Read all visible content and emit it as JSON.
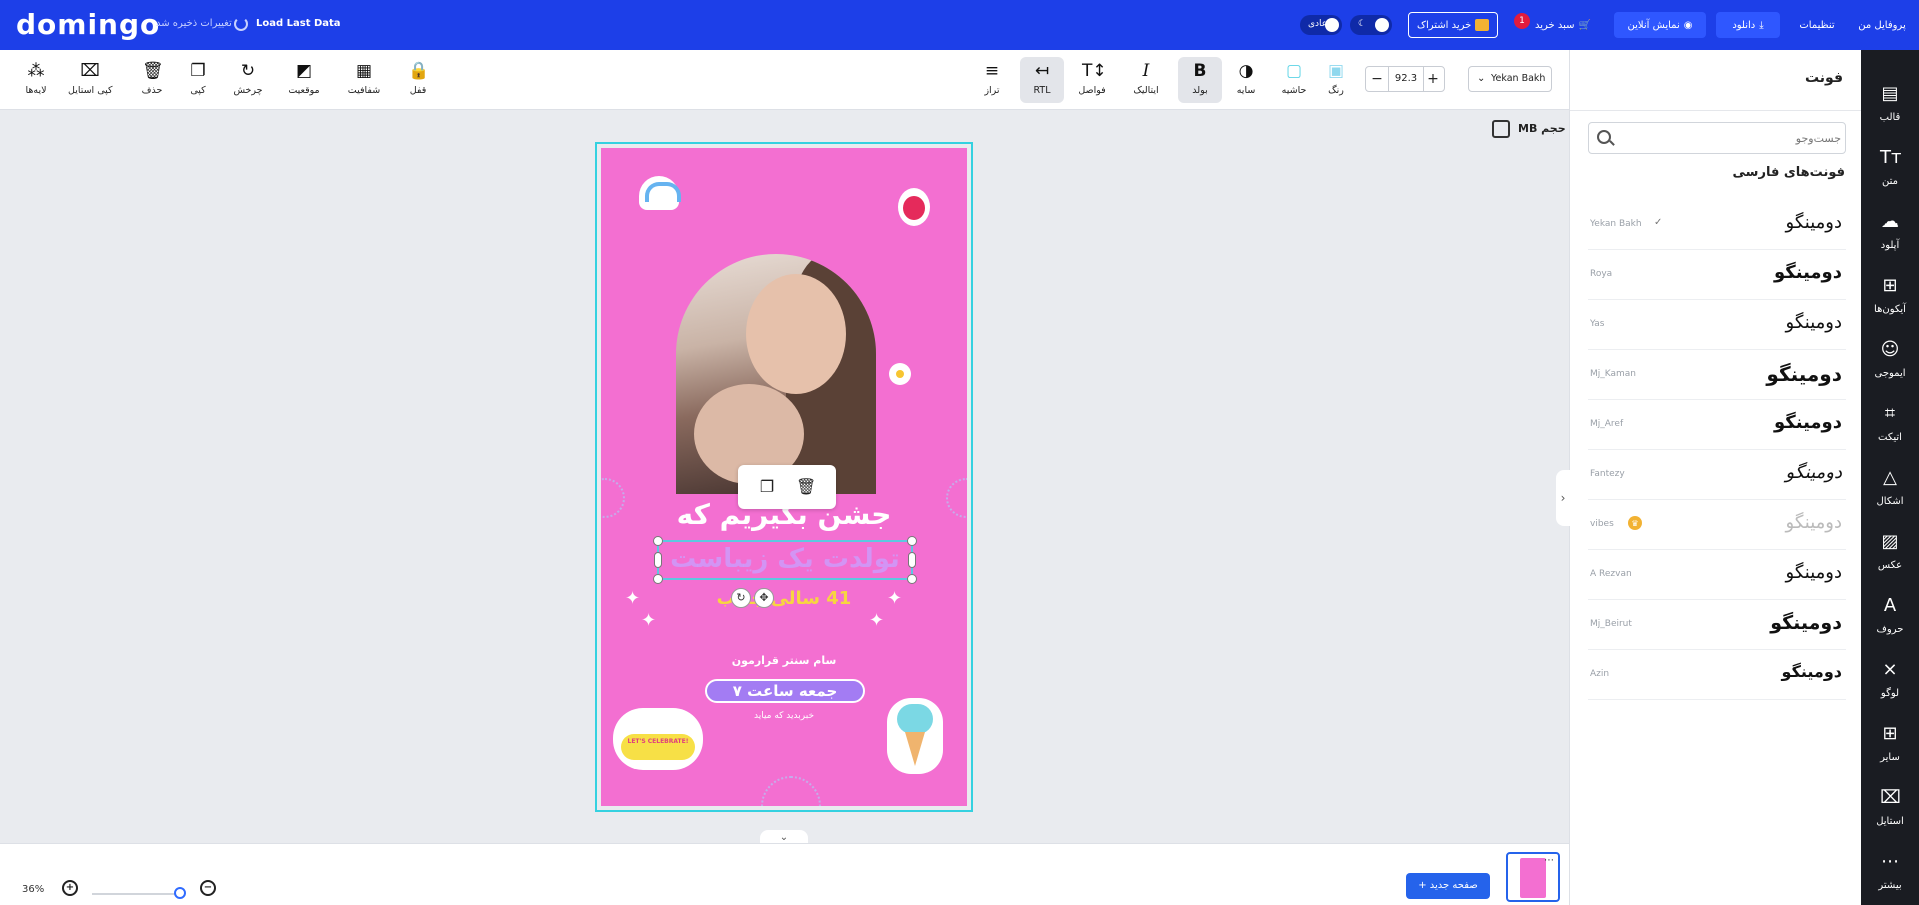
{
  "topbar": {
    "logo": "domingo",
    "saved_status": "تغییرات ذخیره شد",
    "load_last": "Load Last Data",
    "mode_label": "عادی",
    "buy_subscription": "خرید اشتراک",
    "cart": "سبد خرید",
    "cart_badge": "1",
    "online_preview": "نمایش آنلاین",
    "download": "دانلود",
    "settings": "تنظیمات",
    "profile": "پروفایل من"
  },
  "toolbar": {
    "font_name": "Yekan Bakh",
    "font_size": "92.3",
    "color": "رنگ",
    "border": "حاشیه",
    "shadow": "سایه",
    "bold": "بولد",
    "italic": "ایتالیک",
    "spacing": "فواصل",
    "rtl": "RTL",
    "align": "تراز",
    "lock": "قفل",
    "transparency": "شفافیت",
    "position": "موقعیت",
    "rotate": "چرخش",
    "copy": "کپی",
    "delete": "حذف",
    "copy_style": "کپی استایل",
    "layers": "لایه‌ها"
  },
  "canvas": {
    "size_label": "MB حجم",
    "headline": "جشن بگیریم که",
    "selected_text": "تولدت یک زیباست",
    "subline": "41 سالی جذاب",
    "host_line": "سام سنتر قرارمون",
    "date_pill": "جمعه ساعت ۷",
    "note_line": "خبربدید که میاید",
    "sticker_text": "LET'S CELEBRATE!"
  },
  "panel": {
    "title": "فونت",
    "search_placeholder": "جست‌وجو",
    "section_title": "فونت‌های فارسی",
    "fonts": [
      {
        "name": "Yekan Bakh",
        "sample": "دومینگو",
        "selected": true
      },
      {
        "name": "Roya",
        "sample": "دومینگو"
      },
      {
        "name": "Yas",
        "sample": "دومینگو"
      },
      {
        "name": "Mj_Kaman",
        "sample": "دومینگو"
      },
      {
        "name": "Mj_Aref",
        "sample": "دومینگو"
      },
      {
        "name": "Fantezy",
        "sample": "دومینگو"
      },
      {
        "name": "vibes",
        "sample": "دومینگو",
        "premium": true
      },
      {
        "name": "A Rezvan",
        "sample": "دومینگو"
      },
      {
        "name": "Mj_Beirut",
        "sample": "دومینگو"
      },
      {
        "name": "Azin",
        "sample": "دومینگو"
      }
    ]
  },
  "rail": {
    "items": [
      {
        "label": "قالب",
        "icon": "template-icon"
      },
      {
        "label": "متن",
        "icon": "text-icon"
      },
      {
        "label": "آپلود",
        "icon": "upload-icon"
      },
      {
        "label": "آیکون‌ها",
        "icon": "icons-grid-icon"
      },
      {
        "label": "ایموجی",
        "icon": "emoji-icon"
      },
      {
        "label": "اتیکت",
        "icon": "tag-icon"
      },
      {
        "label": "اشکال",
        "icon": "shapes-icon"
      },
      {
        "label": "عکس",
        "icon": "image-icon"
      },
      {
        "label": "حروف",
        "icon": "letter-icon"
      },
      {
        "label": "لوگو",
        "icon": "logo-icon"
      },
      {
        "label": "سایر",
        "icon": "other-icon"
      },
      {
        "label": "استایل",
        "icon": "style-icon"
      },
      {
        "label": "بیشتر",
        "icon": "more-icon"
      }
    ]
  },
  "bottom": {
    "zoom": "36%",
    "zoom_level": 0.36,
    "new_page": "صفحه جدید +"
  },
  "colors": {
    "topbar": "#1d3fe8",
    "rail": "#1a1c22",
    "poster": "#f36fd1",
    "accent": "#2563eb"
  }
}
